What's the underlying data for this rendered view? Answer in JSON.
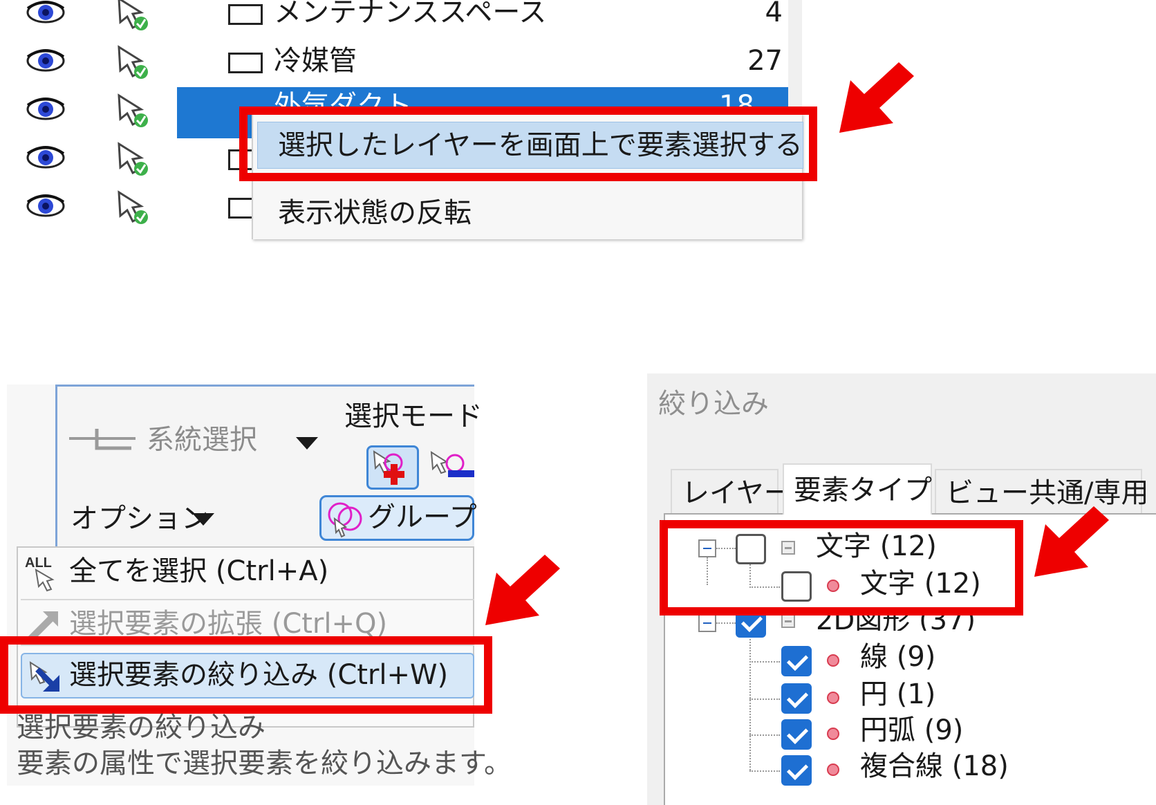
{
  "layer_panel": {
    "rows": [
      {
        "name": "メンテナンススペース",
        "count": "4"
      },
      {
        "name": "冷媒管",
        "count": "27"
      }
    ],
    "selected_row": {
      "name": "外気ダクト",
      "count": "18"
    },
    "context_menu": {
      "item_select_elements": "選択したレイヤーを画面上で要素選択する",
      "item_invert_visibility": "表示状態の反転"
    }
  },
  "ribbon": {
    "system_select_label": "系統選択",
    "select_mode_label": "選択モード",
    "options_label": "オプション",
    "group_label": "グループ"
  },
  "dropdown_menu": {
    "all_icon_text": "ALL",
    "select_all": "全てを選択 (Ctrl+A)",
    "extend_selection": "選択要素の拡張 (Ctrl+Q)",
    "refine_selection": "選択要素の絞り込み (Ctrl+W)"
  },
  "tooltip": {
    "title": "選択要素の絞り込み",
    "description": "要素の属性で選択要素を絞り込みます。"
  },
  "filter_panel": {
    "title": "絞り込み",
    "tabs": [
      "レイヤー",
      "要素タイプ",
      "ビュー共通/専用"
    ],
    "active_tab": "要素タイプ",
    "tree": {
      "group_text": {
        "label": "文字 (12)",
        "checked": false,
        "children": [
          {
            "label": "文字 (12)",
            "checked": false
          }
        ]
      },
      "group_2d": {
        "label": "2D図形 (37)",
        "checked": true,
        "children": [
          {
            "label": "線 (9)",
            "checked": true
          },
          {
            "label": "円 (1)",
            "checked": true
          },
          {
            "label": "円弧 (9)",
            "checked": true
          },
          {
            "label": "複合線 (18)",
            "checked": true
          }
        ]
      }
    }
  },
  "colors": {
    "highlight": "#ee0000",
    "selection_blue": "#1e78d2",
    "checkbox_blue": "#1e6fd2"
  },
  "icons": [
    "eye-icon",
    "visibility-arrow-icon",
    "system-select-icon",
    "add-mode-icon",
    "remove-mode-icon",
    "group-icon",
    "select-all-icon",
    "extend-icon",
    "refine-icon",
    "tree-collapse-icon",
    "element-type-icon"
  ]
}
